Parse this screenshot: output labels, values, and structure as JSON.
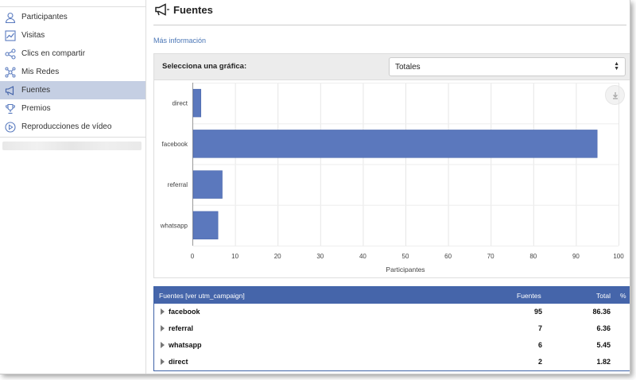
{
  "sidebar": {
    "items": [
      {
        "label": "Participantes",
        "icon": "user-icon"
      },
      {
        "label": "Visitas",
        "icon": "line-chart-icon"
      },
      {
        "label": "Clics en compartir",
        "icon": "share-icon"
      },
      {
        "label": "Mis Redes",
        "icon": "network-icon"
      },
      {
        "label": "Fuentes",
        "icon": "megaphone-icon",
        "active": true
      },
      {
        "label": "Premios",
        "icon": "trophy-icon"
      },
      {
        "label": "Reproducciones de vídeo",
        "icon": "play-icon"
      }
    ]
  },
  "page": {
    "title": "Fuentes",
    "more_info": "Más información"
  },
  "chart_panel": {
    "select_label": "Selecciona una gráfica:",
    "select_value": "Totales"
  },
  "chart_data": {
    "type": "bar",
    "orientation": "horizontal",
    "categories": [
      "direct",
      "facebook",
      "referral",
      "whatsapp"
    ],
    "values": [
      2,
      95,
      7,
      6
    ],
    "xlabel": "Participantes",
    "xlim": [
      0,
      100
    ],
    "xticks": [
      0,
      10,
      20,
      30,
      40,
      50,
      60,
      70,
      80,
      90,
      100
    ],
    "grid": true,
    "bar_color": "#5b78bd"
  },
  "table": {
    "headers": [
      "Fuentes [ver utm_campaign]",
      "Fuentes",
      "Total",
      "%"
    ],
    "rows": [
      {
        "name": "facebook",
        "count": "95",
        "pct": "86.36"
      },
      {
        "name": "referral",
        "count": "7",
        "pct": "6.36"
      },
      {
        "name": "whatsapp",
        "count": "6",
        "pct": "5.45"
      },
      {
        "name": "direct",
        "count": "2",
        "pct": "1.82"
      }
    ]
  },
  "colors": {
    "accent": "#4565aa",
    "active_nav": "#c5cfe3",
    "link": "#4a76b6"
  }
}
